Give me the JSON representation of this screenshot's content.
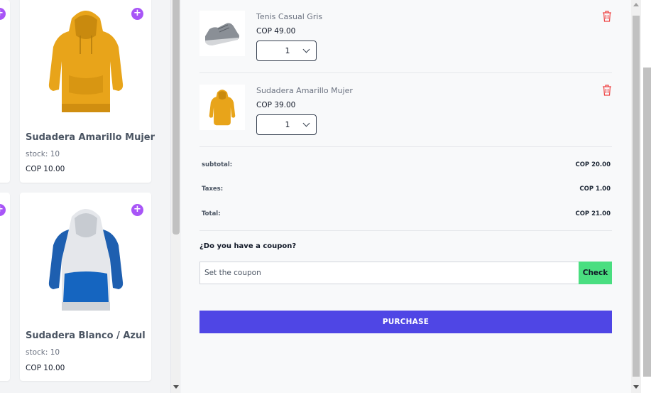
{
  "products": [
    {
      "title": "Sudadera Amarillo Mujer",
      "stock": "stock: 10",
      "price": "COP 10.00",
      "image_icon": "yellow-hoodie-icon"
    },
    {
      "title": "Sudadera Blanco / Azul",
      "stock": "stock: 10",
      "price": "COP 10.00",
      "image_icon": "white-blue-hoodie-icon"
    }
  ],
  "add_label": "+",
  "cart": {
    "items": [
      {
        "name": "Tenis Casual Gris",
        "price": "COP 49.00",
        "qty": "1",
        "image_icon": "gray-sneaker-icon"
      },
      {
        "name": "Sudadera Amarillo Mujer",
        "price": "COP 39.00",
        "qty": "1",
        "image_icon": "yellow-hoodie-icon"
      }
    ],
    "summary": {
      "subtotal_label": "subtotal:",
      "subtotal_value": "COP 20.00",
      "taxes_label": "Taxes:",
      "taxes_value": "COP 1.00",
      "total_label": "Total:",
      "total_value": "COP 21.00"
    },
    "coupon": {
      "question": "¿Do you have a coupon?",
      "placeholder": "Set the coupon",
      "check_label": "Check"
    },
    "purchase_label": "PURCHASE"
  },
  "colors": {
    "accent_purchase": "#4f46e5",
    "check_green": "#4ade80",
    "add_purple": "#a855f7",
    "trash_red": "#ef4444"
  }
}
